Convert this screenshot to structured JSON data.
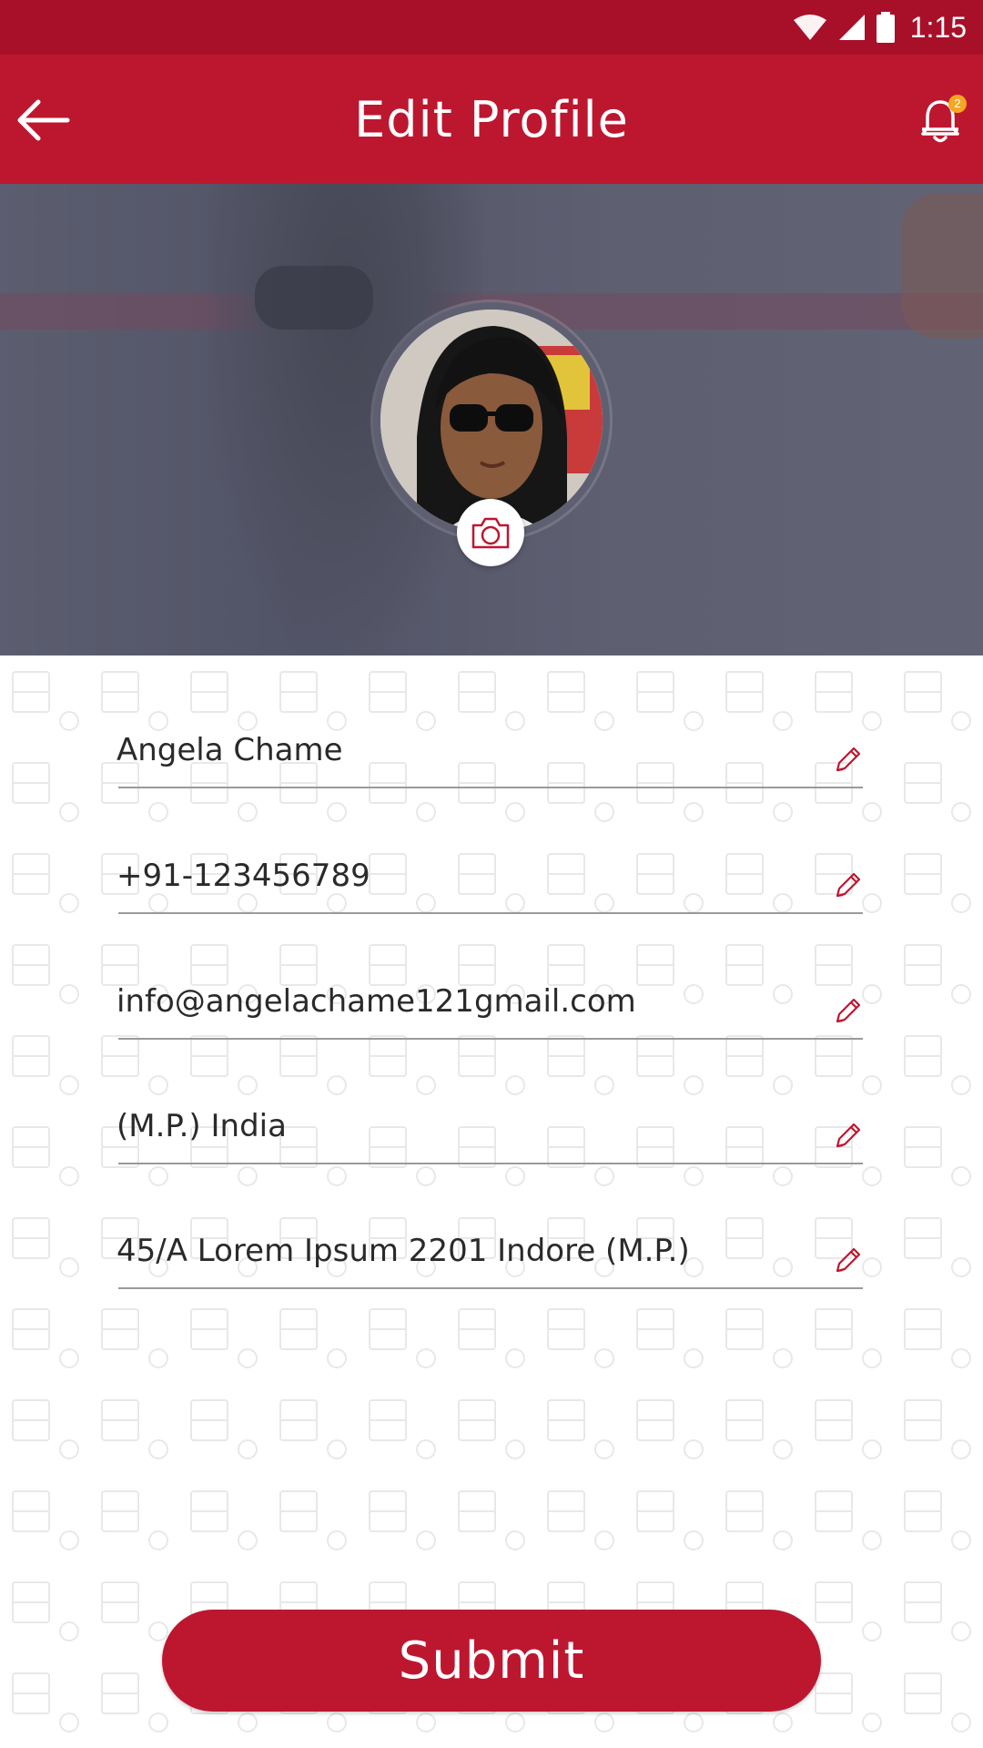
{
  "status_bar": {
    "time": "1:15"
  },
  "header": {
    "title": "Edit Profile",
    "notification_count": "2"
  },
  "profile": {
    "fields": [
      {
        "value": "Angela Chame"
      },
      {
        "value": "+91-123456789"
      },
      {
        "value": "info@angelachame121gmail.com"
      },
      {
        "value": "(M.P.) India"
      },
      {
        "value": "45/A Lorem Ipsum 2201 Indore (M.P.)"
      }
    ]
  },
  "submit": {
    "label": "Submit"
  },
  "colors": {
    "primary": "#bd1730",
    "status_bar": "#a8102a",
    "badge": "#f5a623"
  }
}
